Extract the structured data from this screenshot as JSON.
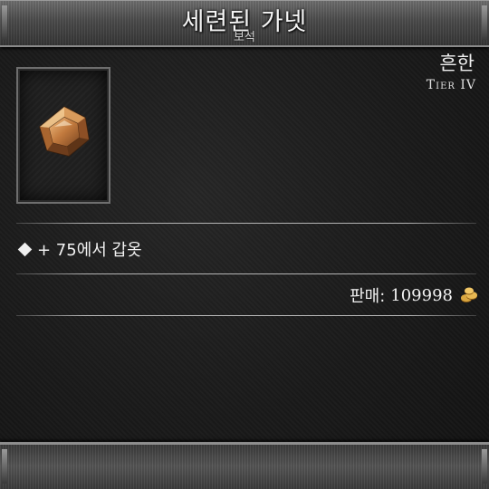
{
  "item": {
    "name": "세련된 가넷",
    "type": "보석",
    "rarity": "흔한",
    "tier": "Tier IV",
    "icon": "garnet-gem-icon"
  },
  "stats": [
    {
      "text": "+ 75에서 갑옷"
    }
  ],
  "sell": {
    "label": "판매:",
    "value": "109998",
    "icon": "gold-coins-icon"
  },
  "colors": {
    "gem": "#b8733a",
    "gold": "#d4a23a",
    "text": "#f2f2f2"
  }
}
